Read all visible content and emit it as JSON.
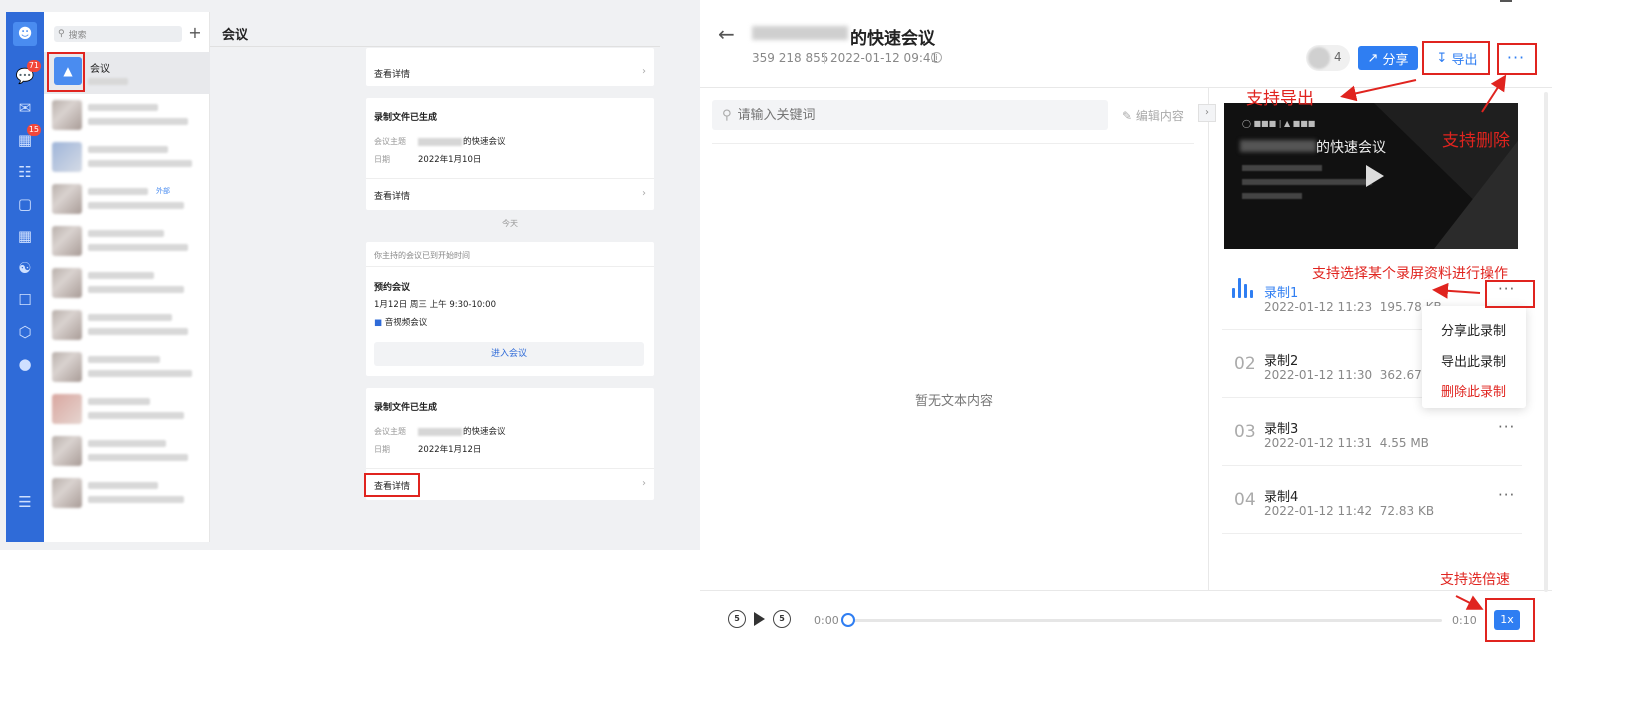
{
  "left": {
    "search_placeholder": "搜索",
    "add_icon": "plus-icon",
    "rail": {
      "messages_badge": "71",
      "workbench_badge": "15"
    },
    "active_conversation": {
      "name": "会议"
    },
    "other_conversation_tag": "外部",
    "chat": {
      "title": "会议",
      "card1": {
        "link": "查看详情"
      },
      "card2": {
        "title": "录制文件已生成",
        "topic_label": "会议主题",
        "topic_value": "的快速会议",
        "date_label": "日期",
        "date_value": "2022年1月10日",
        "link": "查看详情"
      },
      "separator": "今天",
      "card3": {
        "note": "你主持的会议已到开始时间",
        "title": "预约会议",
        "time": "1月12日 周三 上午 9:30-10:00",
        "type": "音视频会议",
        "button": "进入会议"
      },
      "card4": {
        "title": "录制文件已生成",
        "topic_label": "会议主题",
        "topic_value": "的快速会议",
        "date_label": "日期",
        "date_value": "2022年1月12日",
        "link": "查看详情"
      }
    }
  },
  "detail": {
    "title": "的快速会议",
    "meeting_id": "359 218 855",
    "start_time": "2022-01-12 09:41",
    "participant_count": "4",
    "share_label": "分享",
    "export_label": "导出",
    "more_label": "···",
    "search_placeholder": "请输入关键词",
    "edit_label": "编辑内容",
    "empty_text": "暂无文本内容",
    "video_title": "的快速会议",
    "recordings": [
      {
        "num": "",
        "name": "录制1",
        "time": "2022-01-12 11:23",
        "size": "195.78 KB",
        "active": true
      },
      {
        "num": "02",
        "name": "录制2",
        "time": "2022-01-12 11:30",
        "size": "362.67 KB"
      },
      {
        "num": "03",
        "name": "录制3",
        "time": "2022-01-12 11:31",
        "size": "4.55 MB"
      },
      {
        "num": "04",
        "name": "录制4",
        "time": "2022-01-12 11:42",
        "size": "72.83 KB"
      }
    ],
    "recording_menu": [
      "分享此录制",
      "导出此录制",
      "删除此录制"
    ],
    "player": {
      "rewind_label": "5",
      "forward_label": "5",
      "current_time": "0:00",
      "total_time": "0:10",
      "progress": 0,
      "speed": "1x"
    }
  },
  "annotations": {
    "export": "支持导出",
    "delete": "支持删除",
    "select_recording": "支持选择某个录屏资料进行操作",
    "speed": "支持选倍速"
  },
  "colors": {
    "accent": "#2f7ef2",
    "rail": "#2f6bd8",
    "annotation": "#e0241f"
  }
}
